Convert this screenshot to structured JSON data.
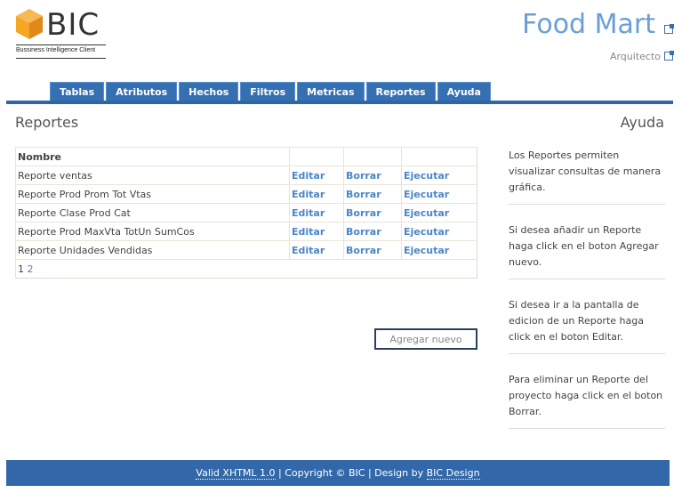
{
  "brand": {
    "name": "BIC",
    "tagline": "Bussiness Intelligence Client",
    "colors": {
      "orange": "#f5a623",
      "blue": "#3570b3"
    }
  },
  "header": {
    "title": "Food Mart",
    "subtitle": "Arquitecto"
  },
  "nav": [
    "Tablas",
    "Atributos",
    "Hechos",
    "Filtros",
    "Metricas",
    "Reportes",
    "Ayuda"
  ],
  "main": {
    "heading": "Reportes",
    "table": {
      "header": "Nombre",
      "rows": [
        {
          "name": "Reporte ventas",
          "edit": "Editar",
          "delete": "Borrar",
          "run": "Ejecutar"
        },
        {
          "name": "Reporte Prod Prom Tot Vtas",
          "edit": "Editar",
          "delete": "Borrar",
          "run": "Ejecutar"
        },
        {
          "name": "Reporte Clase Prod Cat",
          "edit": "Editar",
          "delete": "Borrar",
          "run": "Ejecutar"
        },
        {
          "name": "Reporte Prod MaxVta TotUn SumCos",
          "edit": "Editar",
          "delete": "Borrar",
          "run": "Ejecutar"
        },
        {
          "name": "Reporte Unidades Vendidas",
          "edit": "Editar",
          "delete": "Borrar",
          "run": "Ejecutar"
        }
      ],
      "pager": {
        "current": "1",
        "next": "2"
      }
    },
    "add_label": "Agregar nuevo"
  },
  "help": {
    "heading": "Ayuda",
    "paragraphs": [
      "Los Reportes permiten visualizar consultas de manera gráfica.",
      "Si desea añadir un Reporte haga click en el boton Agregar nuevo.",
      "Si desea ir a la pantalla de edicion de un Reporte haga click en el boton Editar.",
      "Para eliminar un Reporte del proyecto haga click en el boton Borrar."
    ]
  },
  "footer": {
    "valid": "Valid XHTML 1.0",
    "copyright": " | Copyright © BIC | Design by ",
    "design": "BIC Design"
  }
}
